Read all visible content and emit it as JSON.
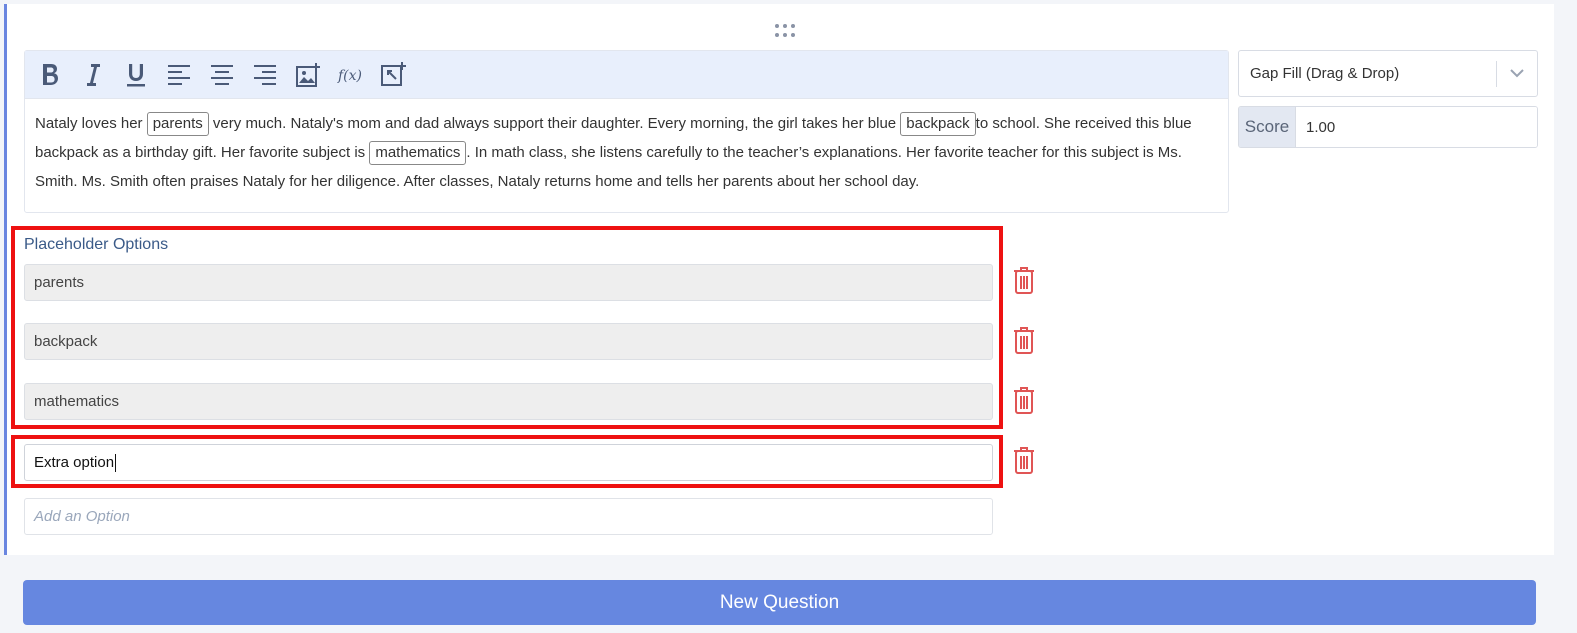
{
  "editor": {
    "toolbar": [
      "bold-icon",
      "italic-icon",
      "underline-icon",
      "align-left-icon",
      "align-center-icon",
      "align-right-icon",
      "insert-image-icon",
      "formula-icon",
      "insert-media-icon"
    ],
    "text": {
      "t1": "Nataly loves her ",
      "gap1": "parents",
      "t2": " very much. Nataly's mom and dad always support their daughter. Every morning, the girl takes her blue ",
      "gap2": "backpack",
      "t3": "to school. She received this blue backpack as a birthday gift. Her favorite subject is ",
      "gap3": "mathematics",
      "t4": ". In math class, she listens carefully to the teacher’s explanations. Her favorite teacher for this subject is Ms. Smith. Ms. Smith often praises Nataly for her diligence. After classes, Nataly returns home and tells her parents about her school day."
    }
  },
  "question_type": {
    "selected": "Gap Fill (Drag & Drop)"
  },
  "score": {
    "label": "Score",
    "value": "1.00"
  },
  "placeholder_options": {
    "title": "Placeholder Options",
    "items": [
      "parents",
      "backpack",
      "mathematics"
    ],
    "extra": "Extra option",
    "add_placeholder": "Add an Option"
  },
  "new_question_label": "New Question",
  "colors": {
    "accent": "#6687e0",
    "highlight": "#ee1111",
    "trash": "#e05555"
  }
}
